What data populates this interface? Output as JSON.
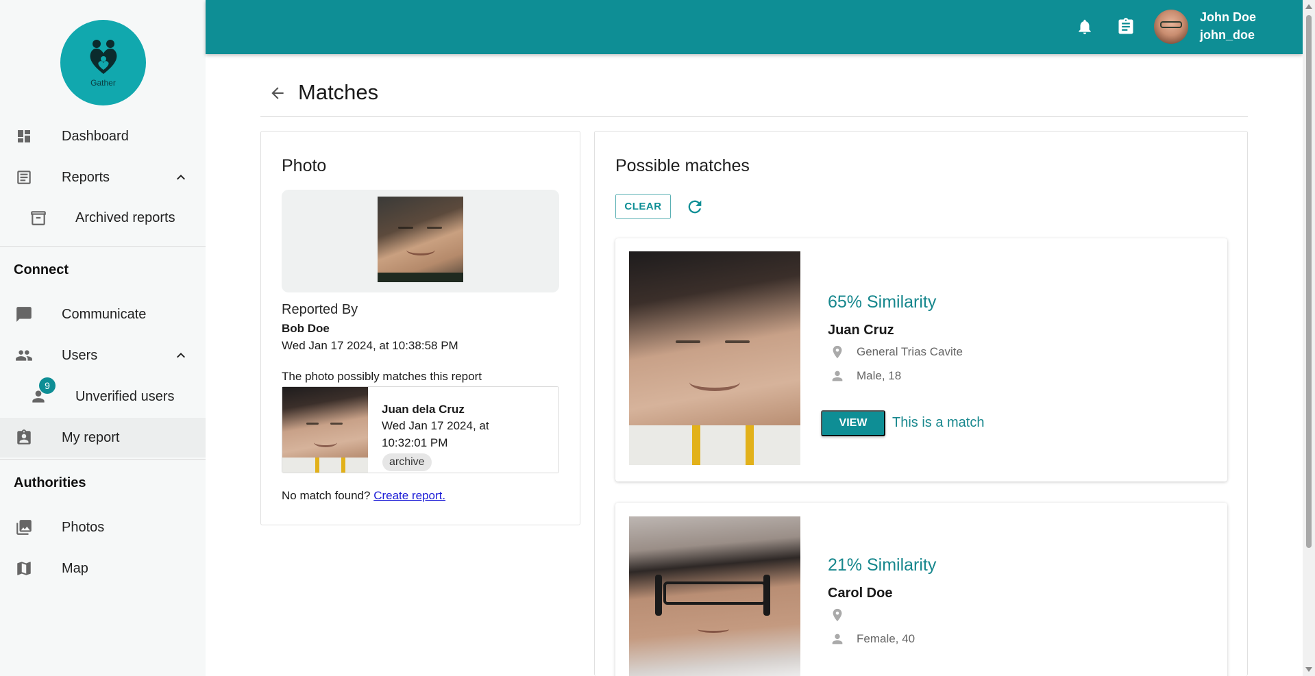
{
  "app": {
    "logo_text": "Gather"
  },
  "sidebar": {
    "items": [
      {
        "label": "Dashboard",
        "icon": "dashboard-icon"
      },
      {
        "label": "Reports",
        "icon": "article-icon"
      },
      {
        "label": "Archived reports",
        "icon": "archive-icon"
      },
      {
        "label": "Communicate",
        "icon": "chat-icon"
      },
      {
        "label": "Users",
        "icon": "people-icon"
      },
      {
        "label": "Unverified users",
        "icon": "person-icon",
        "badge": "9"
      },
      {
        "label": "My report",
        "icon": "assignment-ind-icon"
      },
      {
        "label": "Photos",
        "icon": "photo-library-icon"
      },
      {
        "label": "Map",
        "icon": "map-icon"
      }
    ],
    "sections": {
      "connect": "Connect",
      "authorities": "Authorities"
    }
  },
  "topbar": {
    "user_name": "John Doe",
    "user_handle": "john_doe"
  },
  "page": {
    "title": "Matches"
  },
  "photo_card": {
    "title": "Photo",
    "reported_by_label": "Reported By",
    "reporter": "Bob Doe",
    "reported_at": "Wed Jan 17 2024, at 10:38:58 PM",
    "match_hint": "The photo possibly matches this report",
    "match": {
      "name": "Juan dela Cruz",
      "time_line1": "Wed Jan 17 2024, at",
      "time_line2": "10:32:01 PM",
      "tag": "archive"
    },
    "no_match_text": "No match found?",
    "create_report_link": "Create report."
  },
  "matches_card": {
    "title": "Possible matches",
    "clear_label": "CLEAR",
    "results": [
      {
        "similarity": "65% Similarity",
        "name": "Juan Cruz",
        "location": "General Trias Cavite",
        "details": "Male, 18",
        "view_label": "VIEW",
        "match_label": "This is a match"
      },
      {
        "similarity": "21% Similarity",
        "name": "Carol Doe",
        "location": "",
        "details": "Female, 40"
      }
    ]
  },
  "colors": {
    "primary": "#0e8e95",
    "logo_bg": "#11a8ae",
    "sidebar_bg": "#f6f8f8"
  }
}
